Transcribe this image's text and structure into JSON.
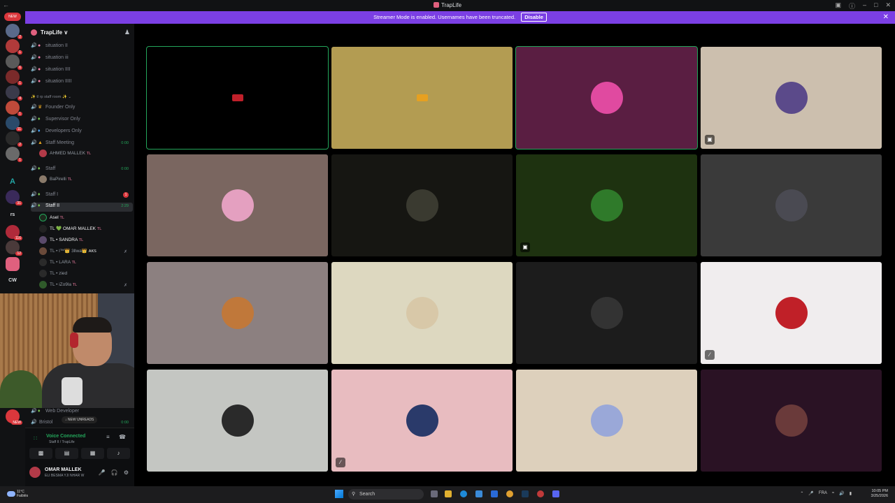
{
  "app": {
    "title": "TrapLife"
  },
  "banner": {
    "text": "Streamer Mode is enabled. Usernames have been truncated.",
    "disable_label": "Disable"
  },
  "guilds": {
    "new_label": "NEW",
    "letters": [
      "A",
      "rs",
      "CW"
    ],
    "new_bottom_label": "NEW"
  },
  "server": {
    "name": "TrapLife ∨"
  },
  "channels": [
    {
      "name": "situation II"
    },
    {
      "name": "situation iii"
    },
    {
      "name": "situation IIII"
    },
    {
      "name": "situation IIIII"
    }
  ],
  "staff_category": "✨ tl rp staff room ✨ ⌄",
  "staff_channels": [
    {
      "name": "Founder Only"
    },
    {
      "name": "Supervisor Only"
    },
    {
      "name": "Developers Only"
    },
    {
      "name": "Staff Meeting",
      "time": "0:00"
    },
    {
      "name": "Staff",
      "time": "0:00"
    },
    {
      "name": "Staff I",
      "count": "1"
    },
    {
      "name": "Staff II",
      "time": "2:29"
    }
  ],
  "meeting_member": {
    "name": "AHMED MALLEK",
    "tag": "TL"
  },
  "staff_member": {
    "name": "BaPirelli",
    "tag": "TL"
  },
  "voice_members": [
    {
      "name": "Asel",
      "tag": "TL"
    },
    {
      "name": "TL 💚 OMAR MALLEK",
      "tag": "TL"
    },
    {
      "name": "TL • SANDRA",
      "tag": "TL"
    },
    {
      "name": "TL • l™👑 3llwa👑",
      "tag": "AKS"
    },
    {
      "name": "TL • LARA",
      "tag": "TL"
    },
    {
      "name": "TL • zied",
      "tag": ""
    },
    {
      "name": "TL • iZo9la",
      "tag": "TL"
    }
  ],
  "lower_channels": [
    {
      "name": "Web Developer"
    },
    {
      "name": "Bristol",
      "time": "0:00"
    }
  ],
  "new_unreads": "↓ NEW UNREADS",
  "voice": {
    "title": "Voice Connected",
    "subtitle": "Staff II / TrapLife"
  },
  "user": {
    "name": "OMAR MALLEK",
    "status": "ELI BESMA YJI NHAR W"
  },
  "tiles": [
    {
      "name": "tile-1",
      "bg": "#000000",
      "avatar": "#c0202a",
      "speaking": true,
      "small": true
    },
    {
      "name": "tile-2",
      "bg": "#b39c52",
      "avatar": "#e6a020",
      "small": true
    },
    {
      "name": "tile-3",
      "bg": "#5a1e42",
      "avatar": "#e04aa0",
      "speaking": true
    },
    {
      "name": "tile-4",
      "bg": "#ccbfae",
      "avatar": "#5b4a8a",
      "badge": "screen"
    },
    {
      "name": "tile-5",
      "bg": "#7a6660",
      "avatar": "#e4a0c0"
    },
    {
      "name": "tile-6",
      "bg": "#161612",
      "avatar": "#3a3a30"
    },
    {
      "name": "tile-7",
      "bg": "#1e3210",
      "avatar": "#2f7a2a",
      "badge": "screen"
    },
    {
      "name": "tile-8",
      "bg": "#3a3a3a",
      "avatar": "#4a4a52"
    },
    {
      "name": "tile-9",
      "bg": "#8c8080",
      "avatar": "#c0783a"
    },
    {
      "name": "tile-10",
      "bg": "#ddd8c0",
      "avatar": "#d8c8a8"
    },
    {
      "name": "tile-11",
      "bg": "#1c1c1c",
      "avatar": "#333333"
    },
    {
      "name": "tile-12",
      "bg": "#f0edee",
      "avatar": "#c02028",
      "badge": "mute"
    },
    {
      "name": "tile-13",
      "bg": "#c4c6c2",
      "avatar": "#2a2a2a"
    },
    {
      "name": "tile-14",
      "bg": "#e8bcc0",
      "avatar": "#2a3a6a",
      "badge": "mute"
    },
    {
      "name": "tile-15",
      "bg": "#ddd0bc",
      "avatar": "#9aa8d8"
    },
    {
      "name": "tile-16",
      "bg": "#2a1224",
      "avatar": "#6a3a3a"
    }
  ],
  "taskbar": {
    "weather_temp": "11°C",
    "weather_desc": "Faiblés",
    "search_placeholder": "Search",
    "lang": "FRA",
    "time": "10:05 PM",
    "date": "3/25/2026"
  }
}
